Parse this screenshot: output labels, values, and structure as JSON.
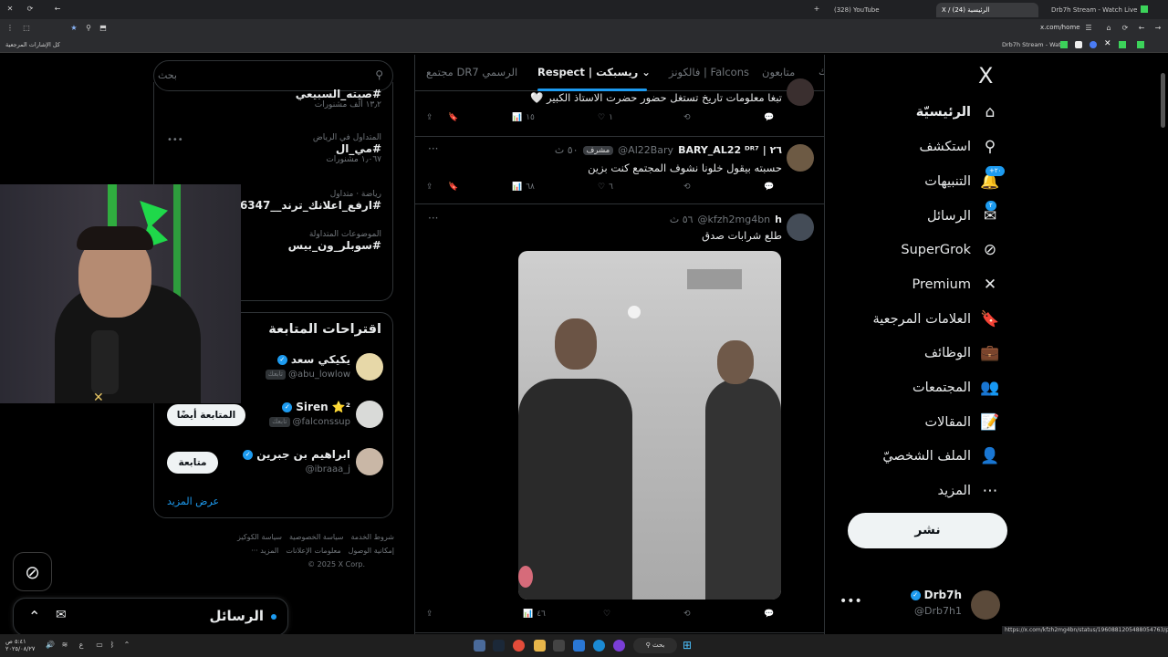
{
  "browser": {
    "tabs": [
      {
        "label": "(328) YouTube"
      },
      {
        "label": "X / الرئيسية (24)"
      },
      {
        "label": "Drb7h Stream - Watch Live on"
      }
    ],
    "url": "x.com/home",
    "bookmarks_label": "كل الإشارات المرجعية",
    "bookmark_right": "Drb7h Stream - Wat...",
    "status_url": "https://x.com/kfzh2mg4bn/status/1960881205488054763/photo/1"
  },
  "nav": {
    "logo": "X",
    "items": [
      {
        "label": "الرئيسيّة",
        "icon": "home-icon",
        "glyph": "⌂"
      },
      {
        "label": "استكشف",
        "icon": "search-icon",
        "glyph": "⚲"
      },
      {
        "label": "التنبيهات",
        "icon": "bell-icon",
        "glyph": "🔔",
        "badge": "+٢٠"
      },
      {
        "label": "الرسائل",
        "icon": "mail-icon",
        "glyph": "✉",
        "badge": "٢"
      },
      {
        "label": "SuperGrok",
        "icon": "grok-icon",
        "glyph": "⊘"
      },
      {
        "label": "Premium",
        "icon": "x-icon",
        "glyph": "✕"
      },
      {
        "label": "العلامات المرجعية",
        "icon": "bookmark-icon",
        "glyph": "🔖"
      },
      {
        "label": "الوظائف",
        "icon": "briefcase-icon",
        "glyph": "💼"
      },
      {
        "label": "المجتمعات",
        "icon": "communities-icon",
        "glyph": "👥"
      },
      {
        "label": "المقالات",
        "icon": "article-icon",
        "glyph": "📝"
      },
      {
        "label": "الملف الشخصيّ",
        "icon": "profile-icon",
        "glyph": "👤"
      },
      {
        "label": "المزيد",
        "icon": "more-circle-icon",
        "glyph": "⋯"
      }
    ],
    "post_label": "نشر",
    "account": {
      "name": "Drb7h",
      "handle": "@Drb7h1"
    }
  },
  "feed": {
    "tabs": [
      "متابعون",
      "فالكونز | Falcons",
      "Respect | ريسبكت",
      "مجتمع DR7 الرسمي"
    ],
    "tweets": [
      {
        "text": "تبغا معلومات تاريخ تستغل حضور حضرت الاستاذ الكبير 🤍",
        "views": "١٥",
        "likes": "١",
        "retweets": "",
        "replies": ""
      },
      {
        "name": "BARY_AL22 ᴰᴿ⁷ | ٢٦",
        "handle": "@Al22Bary",
        "tag": "مشرف",
        "time": "٥٠ ث",
        "text": "حسبته بيقول خلونا نشوف المجتمع كنت بزين",
        "views": "٦٨",
        "likes": "٦",
        "retweets": "",
        "replies": ""
      },
      {
        "name": "h",
        "handle": "@kfzh2mg4bn",
        "time": "٥٦ ث",
        "text": "طلع شرابات صدق",
        "views": "٤٦",
        "likes": "",
        "retweets": "",
        "replies": ""
      }
    ]
  },
  "right": {
    "search_placeholder": "بحث",
    "trends": [
      {
        "meta": "",
        "name": "#صيته_السبيعي",
        "count": "١٣٫٢ ألف مشنورات"
      },
      {
        "meta": "المتداول في الرياض",
        "name": "#مي_ال",
        "count": "١٫٠٦٧ مشنورات"
      },
      {
        "meta": "رياضة · متداول",
        "name": "#ارفع_اعلانك_ترند__0546347",
        "count": ""
      },
      {
        "meta": "الموضوعات المتداولة",
        "name": "#سوبلر_ون_بيس",
        "count": ""
      }
    ],
    "follow_title": "اقتراحات المتابعة",
    "suggestions": [
      {
        "name": "يكيكي سعد",
        "handle": "@abu_lowlow",
        "tag": "تابعك",
        "button": "متابعة"
      },
      {
        "name": "Siren ⭐²",
        "handle": "@falconssup",
        "tag": "تابعك",
        "button": "المتابعة أيضًا"
      },
      {
        "name": "ابراهيم بن جبرين",
        "handle": "@ibraaa_j",
        "tag": "",
        "button": "متابعة"
      }
    ],
    "show_more": "عرض المزيد",
    "footer": {
      "row1": [
        "شروط الخدمة",
        "سياسة الخصوصية",
        "سياسة الكوكيز"
      ],
      "row2": [
        "إمكانية الوصول",
        "معلومات الإعلانات",
        "المزيد ···"
      ],
      "copyright": "© 2025 X Corp."
    }
  },
  "messages_drawer": {
    "title": "الرسائل"
  },
  "taskbar": {
    "search": "بحث",
    "time": "٥:٤١ ص",
    "date": "٢٠٢٥/٠٨/٢٧"
  },
  "colors": {
    "accent": "#1d9bf0",
    "bg": "#000000",
    "border": "#2f3336",
    "muted": "#71767b"
  }
}
